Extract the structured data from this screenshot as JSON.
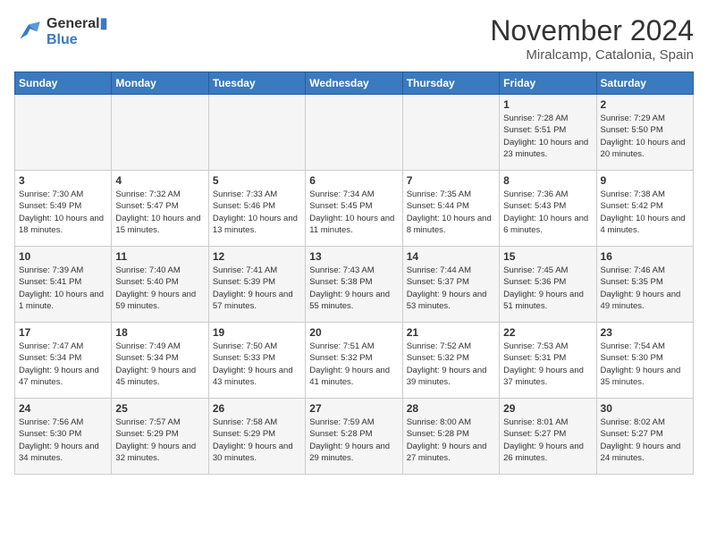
{
  "header": {
    "logo_line1": "General",
    "logo_line2": "Blue",
    "month": "November 2024",
    "location": "Miralcamp, Catalonia, Spain"
  },
  "weekdays": [
    "Sunday",
    "Monday",
    "Tuesday",
    "Wednesday",
    "Thursday",
    "Friday",
    "Saturday"
  ],
  "weeks": [
    [
      {
        "day": "",
        "info": ""
      },
      {
        "day": "",
        "info": ""
      },
      {
        "day": "",
        "info": ""
      },
      {
        "day": "",
        "info": ""
      },
      {
        "day": "",
        "info": ""
      },
      {
        "day": "1",
        "info": "Sunrise: 7:28 AM\nSunset: 5:51 PM\nDaylight: 10 hours and 23 minutes."
      },
      {
        "day": "2",
        "info": "Sunrise: 7:29 AM\nSunset: 5:50 PM\nDaylight: 10 hours and 20 minutes."
      }
    ],
    [
      {
        "day": "3",
        "info": "Sunrise: 7:30 AM\nSunset: 5:49 PM\nDaylight: 10 hours and 18 minutes."
      },
      {
        "day": "4",
        "info": "Sunrise: 7:32 AM\nSunset: 5:47 PM\nDaylight: 10 hours and 15 minutes."
      },
      {
        "day": "5",
        "info": "Sunrise: 7:33 AM\nSunset: 5:46 PM\nDaylight: 10 hours and 13 minutes."
      },
      {
        "day": "6",
        "info": "Sunrise: 7:34 AM\nSunset: 5:45 PM\nDaylight: 10 hours and 11 minutes."
      },
      {
        "day": "7",
        "info": "Sunrise: 7:35 AM\nSunset: 5:44 PM\nDaylight: 10 hours and 8 minutes."
      },
      {
        "day": "8",
        "info": "Sunrise: 7:36 AM\nSunset: 5:43 PM\nDaylight: 10 hours and 6 minutes."
      },
      {
        "day": "9",
        "info": "Sunrise: 7:38 AM\nSunset: 5:42 PM\nDaylight: 10 hours and 4 minutes."
      }
    ],
    [
      {
        "day": "10",
        "info": "Sunrise: 7:39 AM\nSunset: 5:41 PM\nDaylight: 10 hours and 1 minute."
      },
      {
        "day": "11",
        "info": "Sunrise: 7:40 AM\nSunset: 5:40 PM\nDaylight: 9 hours and 59 minutes."
      },
      {
        "day": "12",
        "info": "Sunrise: 7:41 AM\nSunset: 5:39 PM\nDaylight: 9 hours and 57 minutes."
      },
      {
        "day": "13",
        "info": "Sunrise: 7:43 AM\nSunset: 5:38 PM\nDaylight: 9 hours and 55 minutes."
      },
      {
        "day": "14",
        "info": "Sunrise: 7:44 AM\nSunset: 5:37 PM\nDaylight: 9 hours and 53 minutes."
      },
      {
        "day": "15",
        "info": "Sunrise: 7:45 AM\nSunset: 5:36 PM\nDaylight: 9 hours and 51 minutes."
      },
      {
        "day": "16",
        "info": "Sunrise: 7:46 AM\nSunset: 5:35 PM\nDaylight: 9 hours and 49 minutes."
      }
    ],
    [
      {
        "day": "17",
        "info": "Sunrise: 7:47 AM\nSunset: 5:34 PM\nDaylight: 9 hours and 47 minutes."
      },
      {
        "day": "18",
        "info": "Sunrise: 7:49 AM\nSunset: 5:34 PM\nDaylight: 9 hours and 45 minutes."
      },
      {
        "day": "19",
        "info": "Sunrise: 7:50 AM\nSunset: 5:33 PM\nDaylight: 9 hours and 43 minutes."
      },
      {
        "day": "20",
        "info": "Sunrise: 7:51 AM\nSunset: 5:32 PM\nDaylight: 9 hours and 41 minutes."
      },
      {
        "day": "21",
        "info": "Sunrise: 7:52 AM\nSunset: 5:32 PM\nDaylight: 9 hours and 39 minutes."
      },
      {
        "day": "22",
        "info": "Sunrise: 7:53 AM\nSunset: 5:31 PM\nDaylight: 9 hours and 37 minutes."
      },
      {
        "day": "23",
        "info": "Sunrise: 7:54 AM\nSunset: 5:30 PM\nDaylight: 9 hours and 35 minutes."
      }
    ],
    [
      {
        "day": "24",
        "info": "Sunrise: 7:56 AM\nSunset: 5:30 PM\nDaylight: 9 hours and 34 minutes."
      },
      {
        "day": "25",
        "info": "Sunrise: 7:57 AM\nSunset: 5:29 PM\nDaylight: 9 hours and 32 minutes."
      },
      {
        "day": "26",
        "info": "Sunrise: 7:58 AM\nSunset: 5:29 PM\nDaylight: 9 hours and 30 minutes."
      },
      {
        "day": "27",
        "info": "Sunrise: 7:59 AM\nSunset: 5:28 PM\nDaylight: 9 hours and 29 minutes."
      },
      {
        "day": "28",
        "info": "Sunrise: 8:00 AM\nSunset: 5:28 PM\nDaylight: 9 hours and 27 minutes."
      },
      {
        "day": "29",
        "info": "Sunrise: 8:01 AM\nSunset: 5:27 PM\nDaylight: 9 hours and 26 minutes."
      },
      {
        "day": "30",
        "info": "Sunrise: 8:02 AM\nSunset: 5:27 PM\nDaylight: 9 hours and 24 minutes."
      }
    ]
  ]
}
